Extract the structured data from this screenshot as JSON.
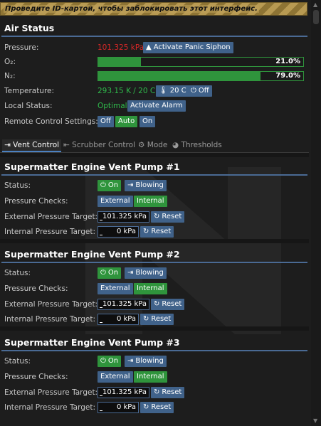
{
  "notice": "Проведите ID-картой, чтобы заблокировать этот интерфейс.",
  "air_status": {
    "title": "Air Status",
    "pressure_label": "Pressure:",
    "pressure_value": "101.325 kPa",
    "panic_button": "Activate Panic Siphon",
    "o2_label": "O₂:",
    "o2_value": "21.0%",
    "o2_fraction": 0.21,
    "n2_label": "N₂:",
    "n2_value": "79.0%",
    "n2_fraction": 0.79,
    "temp_label": "Temperature:",
    "temp_value": "293.15 K / 20 C",
    "temp_button": "20 C",
    "temp_off": "Off",
    "local_label": "Local Status:",
    "local_value": "Optimal",
    "alarm_button": "Activate Alarm",
    "remote_label": "Remote Control Settings:",
    "remote_off": "Off",
    "remote_auto": "Auto",
    "remote_on": "On"
  },
  "tabs": [
    "Vent Control",
    "Scrubber Control",
    "Mode",
    "Thresholds"
  ],
  "pumps": [
    {
      "title": "Supermatter Engine Vent Pump #1",
      "status_label": "Status:",
      "on": "On",
      "blowing": "Blowing",
      "checks_label": "Pressure Checks:",
      "external": "External",
      "internal": "Internal",
      "ext_label": "External Pressure Target:",
      "ext_value": "101.325 kPa",
      "reset": "Reset",
      "int_label": "Internal Pressure Target:",
      "int_value": "0 kPa"
    },
    {
      "title": "Supermatter Engine Vent Pump #2",
      "status_label": "Status:",
      "on": "On",
      "blowing": "Blowing",
      "checks_label": "Pressure Checks:",
      "external": "External",
      "internal": "Internal",
      "ext_label": "External Pressure Target:",
      "ext_value": "101.325 kPa",
      "reset": "Reset",
      "int_label": "Internal Pressure Target:",
      "int_value": "0 kPa"
    },
    {
      "title": "Supermatter Engine Vent Pump #3",
      "status_label": "Status:",
      "on": "On",
      "blowing": "Blowing",
      "checks_label": "Pressure Checks:",
      "external": "External",
      "internal": "Internal",
      "ext_label": "External Pressure Target:",
      "ext_value": "101.325 kPa",
      "reset": "Reset",
      "int_label": "Internal Pressure Target:",
      "int_value": "0 kPa"
    }
  ],
  "colors": {
    "accent": "#40628a",
    "good": "#2f943c",
    "bad": "#db2828",
    "rule": "#4a6a94"
  },
  "icons": {
    "panic": "exclamation-triangle-icon",
    "temp": "thermometer-icon",
    "power": "power-icon",
    "vent": "vent-icon",
    "scrubber": "filter-icon",
    "mode": "gear-icon",
    "thresholds": "gauge-icon",
    "blowing": "sign-out-icon",
    "reset": "undo-icon"
  }
}
